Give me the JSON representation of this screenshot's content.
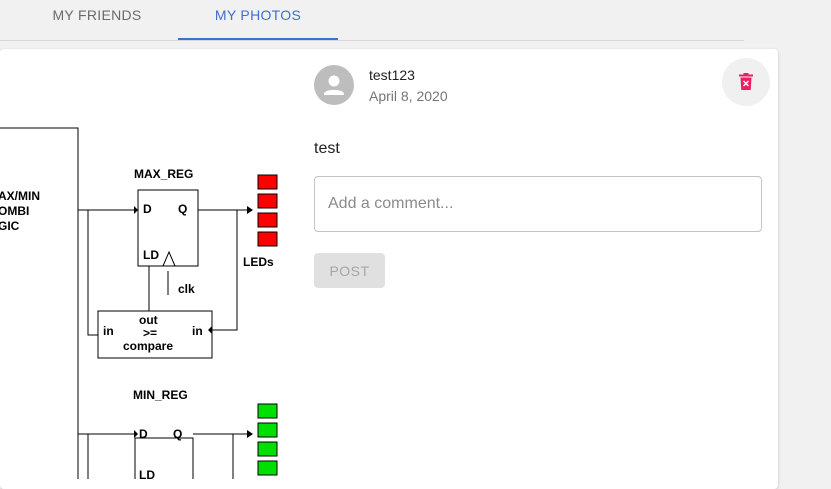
{
  "tabs": [
    {
      "label": "MY FRIENDS",
      "active": false
    },
    {
      "label": "MY PHOTOS",
      "active": true
    }
  ],
  "colors": {
    "accent": "#3f6fcf",
    "delete_icon": "#e91e63",
    "led_red": "#ff0000",
    "led_green": "#00e000"
  },
  "post": {
    "username": "test123",
    "date": "April 8, 2020",
    "caption": "test",
    "comment_placeholder": "Add a comment...",
    "comment_value": "",
    "post_button_label": "POST"
  },
  "photo_diagram": {
    "left_block_text": [
      "AX/MIN",
      "OMBI",
      "GIC"
    ],
    "max_reg": {
      "title": "MAX_REG",
      "pins": [
        "D",
        "Q",
        "LD"
      ]
    },
    "min_reg": {
      "title": "MIN_REG",
      "pins": [
        "D",
        "Q",
        "LD"
      ]
    },
    "leds_label": "LEDs",
    "clk_label": "clk",
    "compare": {
      "top": "out",
      "middle": ">=",
      "bottom": "compare",
      "in_left": "in",
      "in_right": "in"
    }
  }
}
